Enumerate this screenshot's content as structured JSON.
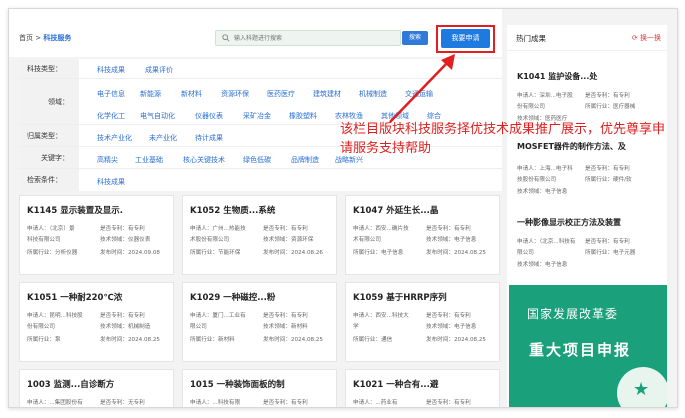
{
  "breadcrumb": {
    "home": "首页",
    "sep": " > ",
    "current": "科技服务"
  },
  "search": {
    "placeholder": "输入科题进行搜索",
    "button_label": "搜索"
  },
  "apply_button": "我要申请",
  "filters": {
    "tech_type": {
      "label": "科技类型：",
      "options": [
        "科技成果",
        "成果评价"
      ]
    },
    "domain": {
      "label": "领域：",
      "row1": [
        "电子信息",
        "新能源",
        "新材料",
        "资源环保",
        "医药医疗",
        "建筑建材",
        "机械制造",
        "交通运输"
      ],
      "row2": [
        "化学化工",
        "电气自动化",
        "仪器仪表",
        "采矿冶金",
        "橡胶塑料",
        "农林牧渔",
        "其他领域",
        "综合"
      ]
    },
    "category": {
      "label": "归属类型：",
      "options": [
        "技术产业化",
        "未产业化",
        "待计成果"
      ]
    },
    "keyword": {
      "label": "关键字：",
      "options": [
        "高精尖",
        "工业基础",
        "核心关键技术",
        "绿色低碳",
        "品牌制造",
        "战略新兴"
      ]
    },
    "conditions": {
      "label": "检索条件：",
      "options": [
        "科技成果"
      ]
    }
  },
  "cards": [
    {
      "title": "K1145 显示装置及显示.",
      "l1a": "申请人：（北京）景",
      "l1b": "是否专利：有专利",
      "l2a": "科技有限公司",
      "l2b": "技术领域：仪器仪表",
      "l3a": "所属行业：分析仪器",
      "l3b": "发布时间：2024.09.08"
    },
    {
      "title": "K1052 生物质...系统",
      "l1a": "申请人：广州...热能技",
      "l1b": "是否专利：有专利",
      "l2a": "术股份有限公司",
      "l2b": "技术领域：资源环保",
      "l3a": "所属行业：节能环保",
      "l3b": "发布时间：2024.08.26"
    },
    {
      "title": "K1047 外延生长...晶",
      "l1a": "申请人：西安...确片技",
      "l1b": "是否专利：有专利",
      "l2a": "术有限公司",
      "l2b": "技术领域：电子信息",
      "l3a": "所属行业：电子信息",
      "l3b": "发布时间：2024.08.25"
    },
    {
      "title": "K1051 一种耐220℃浓",
      "l1a": "申请人：昆明...科技股",
      "l1b": "是否专利：有专利",
      "l2a": "份有限公司",
      "l2b": "技术领域：机械制造",
      "l3a": "所属行业：泵",
      "l3b": "发布时间：2024.08.25"
    },
    {
      "title": "K1029 一种磁控...粉",
      "l1a": "申请人：厦门...工业有",
      "l1b": "是否专利：有专利",
      "l2a": "限公司",
      "l2b": "技术领域：新材料",
      "l3a": "所属行业：新材料",
      "l3b": "发布时间：2024.08.25"
    },
    {
      "title": "K1059 基于HRRP序列",
      "l1a": "申请人：西安...科技大",
      "l1b": "是否专利：有专利",
      "l2a": "学",
      "l2b": "技术领域：电子信息",
      "l3a": "所属行业：通信",
      "l3b": "发布时间：2024.08.25"
    },
    {
      "title": "1003 监测...自诊断方",
      "l1a": "申请人：...集团股份有",
      "l1b": "是否专利：无专利",
      "l2a": "",
      "l2b": "",
      "l3a": "",
      "l3b": ""
    },
    {
      "title": "1015 一种装饰面板的制",
      "l1a": "申请人：...科技有限",
      "l1b": "是否专利：有专利",
      "l2a": "",
      "l2b": "",
      "l3a": "",
      "l3b": ""
    },
    {
      "title": "K1021 一种合有...避",
      "l1a": "申请人：...药业有",
      "l1b": "是否专利：有专利",
      "l2a": "",
      "l2b": "",
      "l3a": "",
      "l3b": ""
    }
  ],
  "sidebar": {
    "title": "热门成果",
    "refresh": "换一换",
    "items": [
      {
        "title": "K1041 监护设备...处",
        "a1": "申请人：深圳...电子股",
        "b1": "是否专利：有专利",
        "a2": "份有限公司",
        "b2": "所属行业：医疗器械",
        "a3": "技术领域：医药医疗",
        "b3": ""
      },
      {
        "title": "MOSFET器件的制作方法、及",
        "a1": "申请人：上海...电子科",
        "b1": "是否专利：有专利",
        "a2": "技股份有限公司",
        "b2": "所属行业：硬件/软",
        "a3": "技术领域：电子信息",
        "b3": ""
      },
      {
        "title": "一种影像显示校正方法及装置",
        "a1": "申请人：（北京...科技有",
        "b1": "是否专利：有专利",
        "a2": "限公司",
        "b2": "所属行业：电子元器",
        "a3": "技术领域：电子信息",
        "b3": ""
      }
    ]
  },
  "banner": {
    "line1": "国家发展改革委",
    "line2": "重大项目申报"
  },
  "annotation": "该栏目版块科技服务择优技术成果推广展示，优先尊享申请服务支持帮助",
  "colors": {
    "accent": "#1f7ae0",
    "annotation": "#e02020",
    "banner": "#1aa07a"
  }
}
